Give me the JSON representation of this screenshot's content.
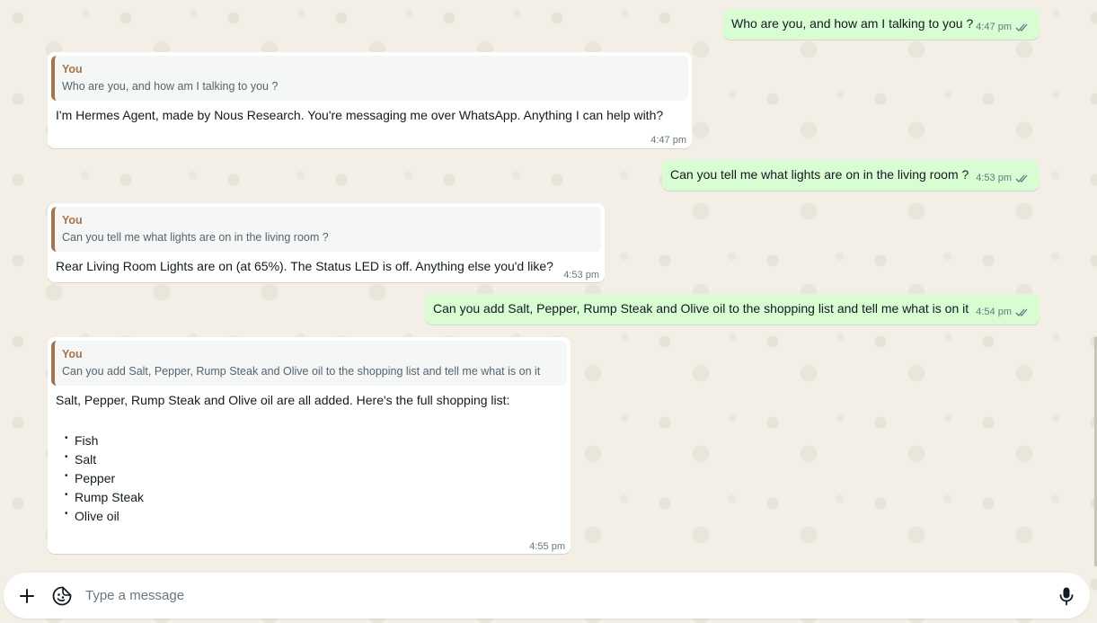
{
  "conversation": {
    "messages": [
      {
        "direction": "outgoing",
        "text": "Who are you, and how am I talking to you ?",
        "time": "4:47 pm"
      },
      {
        "direction": "incoming",
        "quote": {
          "author": "You",
          "text": "Who are you, and how am I talking to you ?"
        },
        "text": "I'm Hermes Agent, made by Nous Research. You're messaging me over WhatsApp. Anything I can help with?",
        "time": "4:47 pm"
      },
      {
        "direction": "outgoing",
        "text": "Can you tell me what lights are on in the living room ?",
        "time": "4:53 pm"
      },
      {
        "direction": "incoming",
        "quote": {
          "author": "You",
          "text": "Can you tell me what lights are on in the living room ?"
        },
        "text": "Rear Living Room Lights are on (at 65%). The Status LED is off. Anything else you'd like?",
        "time": "4:53 pm"
      },
      {
        "direction": "outgoing",
        "text": "Can you add Salt, Pepper, Rump Steak and Olive oil to the shopping list and tell me what is on it",
        "time": "4:54 pm"
      },
      {
        "direction": "incoming",
        "quote": {
          "author": "You",
          "text": "Can you add Salt, Pepper, Rump Steak and Olive oil to the shopping list and tell me what is on it"
        },
        "text": "Salt, Pepper, Rump Steak and Olive oil are all added. Here's the full shopping list:",
        "list_bullet": "•",
        "list": [
          "Fish",
          "Salt",
          "Pepper",
          "Rump Steak",
          "Olive oil"
        ],
        "time": "4:55 pm"
      }
    ]
  },
  "composer": {
    "placeholder": "Type a message",
    "icons": {
      "attach": "plus-icon",
      "emoji": "sticker-icon",
      "voice": "microphone-icon"
    }
  },
  "colors": {
    "outgoing_bubble": "#d9fdd3",
    "incoming_bubble": "#ffffff",
    "quote_accent": "#a5744a",
    "read_ticks": "#667781",
    "wallpaper": "#f3efe7"
  }
}
